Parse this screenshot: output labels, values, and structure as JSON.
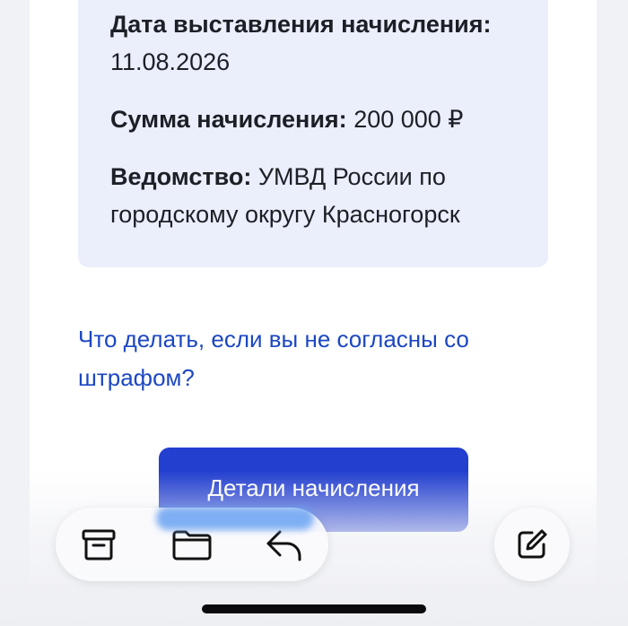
{
  "charge": {
    "date_label": "Дата выставления начисления:",
    "date_value": "11.08.2026",
    "sum_label": "Сумма начисления:",
    "sum_value": "200 000 ₽",
    "department_label": "Ведомство:",
    "department_value": "УМВД России по городскому округу Красногорск"
  },
  "dispute_link": "Что делать, если вы не согласны со штрафом?",
  "details_button": "Детали начисления",
  "toolbar": {
    "icons": [
      "archive-icon",
      "folder-icon",
      "reply-icon"
    ],
    "compose_icon": "compose-icon"
  },
  "colors": {
    "link": "#1c47c2",
    "button": "#233fcf",
    "card": "#ebeefb"
  }
}
